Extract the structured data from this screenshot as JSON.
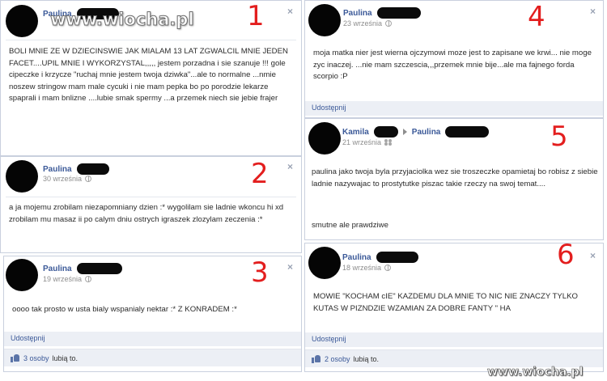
{
  "watermark_top": "www.wiocha.pl",
  "watermark_bottom": "www.wiocha.pl",
  "colors": {
    "link": "#3b5998",
    "annotation": "#e31e1e",
    "panel_border": "#c9d0de",
    "bar_bg": "#eceff5"
  },
  "icons": [
    "close-icon",
    "globe-icon",
    "friends-icon",
    "thumbs-up-icon",
    "arrow-right-icon"
  ],
  "panels": [
    {
      "number": "1",
      "author": "Paulina",
      "close": "×",
      "text": "BOLI MNIE ZE W DZIECINSWIE JAK MIALAM 13 LAT ZGWALCIL MNIE JEDEN FACET....UPIL MNIE I WYKORZYSTAL,,,,, jestem porzadna i sie szanuje !!! gole cipeczke i krzycze \"ruchaj mnie jestem twoja dziwka\"...ale to normalne ...nmie noszew stringow mam male cycuki i nie mam pepka bo po porodzie lekarze spaprali i mam bnlizne ....lubie smak spermy ...a przemek niech sie jebie frajer"
    },
    {
      "number": "2",
      "author": "Paulina",
      "date": "30 września",
      "close": "×",
      "text": "a ja mojemu zrobilam niezapomniany dzien :* wygolilam sie ladnie wkoncu hi xd zrobilam mu masaz ii po calym dniu ostrych igraszek zlozylam zeczenia :*"
    },
    {
      "number": "3",
      "author": "Paulina",
      "date": "19 września",
      "close": "×",
      "text": "oooo tak prosto w usta bialy wspanialy nektar :* Z KONRADEM :*",
      "share": "Udostępnij",
      "likes_count": "3 osoby",
      "likes_suffix": "lubią to."
    },
    {
      "number": "4",
      "author": "Paulina",
      "date": "23 września",
      "close": "×",
      "text": "moja matka nier jest wierna ojczymowi moze jest to zapisane we krwi... nie moge zyc inaczej. ...nie mam szczescia,,,przemek mnie bije...ale ma fajnego forda scorpio :P",
      "share": "Udostępnij"
    },
    {
      "number": "5",
      "author": "Kamila",
      "recipient": "Paulina",
      "date": "21 września",
      "text": "paulina jako twoja byla przyjaciolka wez sie troszeczke opamietaj bo robisz z siebie ladnie nazywajac to prostytutke piszac takie rzeczy na swoj temat....",
      "text2": "smutne ale prawdziwe"
    },
    {
      "number": "6",
      "author": "Paulina",
      "date": "18 września",
      "close": "×",
      "text": "MOWIE \"KOCHAM cIE\" KAZDEMU DLA MNIE TO NIC NIE ZNACZY TYLKO KUTAS W PIZNDZIE WZAMIAN ZA DOBRE FANTY \" HA",
      "share": "Udostępnij",
      "likes_count": "2 osoby",
      "likes_suffix": "lubią to."
    }
  ]
}
